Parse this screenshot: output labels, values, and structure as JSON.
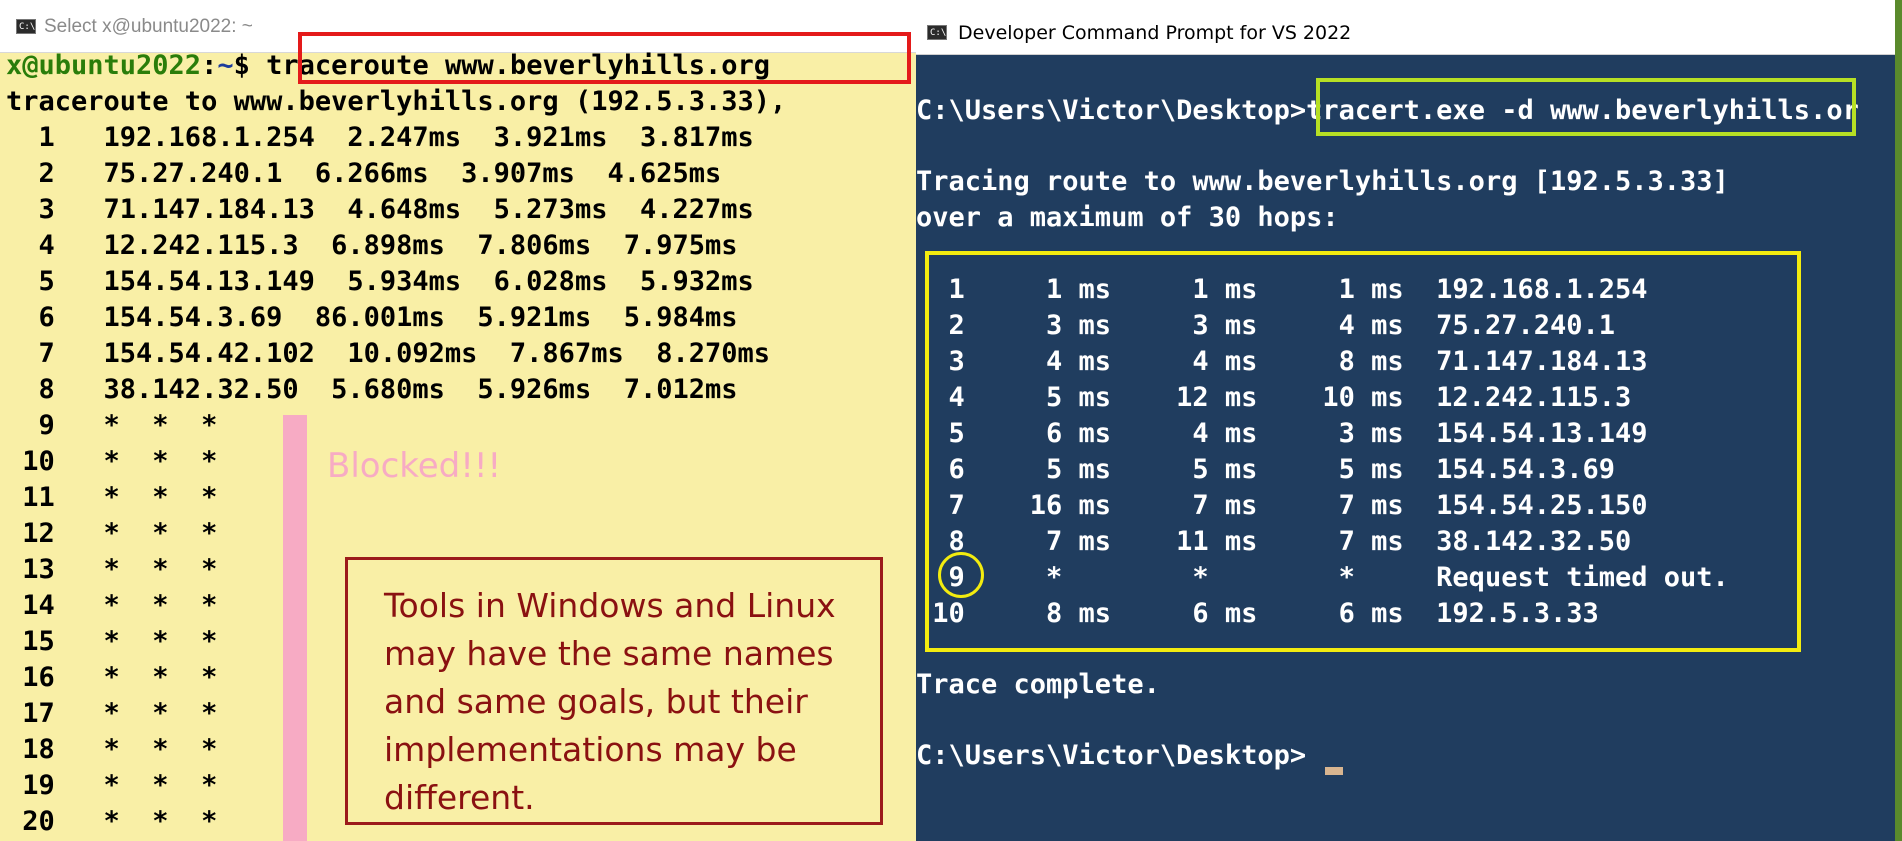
{
  "left_window": {
    "title": "Select x@ubuntu2022: ~",
    "prompt": {
      "user": "x@ubuntu2022",
      "sep": ":",
      "path": "~",
      "symbol": "$"
    },
    "command": "traceroute www.beverlyhills.org",
    "header": "traceroute to www.beverlyhills.org (192.5.3.33),",
    "hops": [
      "  1   192.168.1.254  2.247ms  3.921ms  3.817ms",
      "  2   75.27.240.1  6.266ms  3.907ms  4.625ms",
      "  3   71.147.184.13  4.648ms  5.273ms  4.227ms",
      "  4   12.242.115.3  6.898ms  7.806ms  7.975ms",
      "  5   154.54.13.149  5.934ms  6.028ms  5.932ms",
      "  6   154.54.3.69  86.001ms  5.921ms  5.984ms",
      "  7   154.54.42.102  10.092ms  7.867ms  8.270ms",
      "  8   38.142.32.50  5.680ms  5.926ms  7.012ms",
      "  9   *  *  *",
      " 10   *  *  *",
      " 11   *  *  *",
      " 12   *  *  *",
      " 13   *  *  *",
      " 14   *  *  *",
      " 15   *  *  *",
      " 16   *  *  *",
      " 17   *  *  *",
      " 18   *  *  *",
      " 19   *  *  *",
      " 20   *  *  *"
    ],
    "blocked_label": "Blocked!!!",
    "note": "Tools in Windows and Linux may have the same names and same goals, but their implementations may be different."
  },
  "right_window": {
    "title": "Developer Command Prompt for VS 2022",
    "prompt": "C:\\Users\\Victor\\Desktop>",
    "command": "tracert.exe -d www.beverlyhills.or",
    "tracing_line": "Tracing route to www.beverlyhills.org [192.5.3.33]",
    "max_hops_line": "over a maximum of 30 hops:",
    "hops": [
      "  1     1 ms     1 ms     1 ms  192.168.1.254",
      "  2     3 ms     3 ms     4 ms  75.27.240.1",
      "  3     4 ms     4 ms     8 ms  71.147.184.13",
      "  4     5 ms    12 ms    10 ms  12.242.115.3",
      "  5     6 ms     4 ms     3 ms  154.54.13.149",
      "  6     5 ms     5 ms     5 ms  154.54.3.69",
      "  7    16 ms     7 ms     7 ms  154.54.25.150",
      "  8     7 ms    11 ms     7 ms  38.142.32.50",
      "  9     *        *        *     Request timed out.",
      " 10     8 ms     6 ms     6 ms  192.5.3.33"
    ],
    "complete_line": "Trace complete.",
    "final_prompt": "C:\\Users\\Victor\\Desktop>"
  },
  "colors": {
    "left_bg": "#f9efa6",
    "right_bg": "#203d5f",
    "highlight_red": "#e41a1a",
    "highlight_green": "#b7e024",
    "highlight_yellow": "#f3ec0f",
    "note_red": "#8a1111",
    "blocked_pink": "#f7abc4"
  }
}
